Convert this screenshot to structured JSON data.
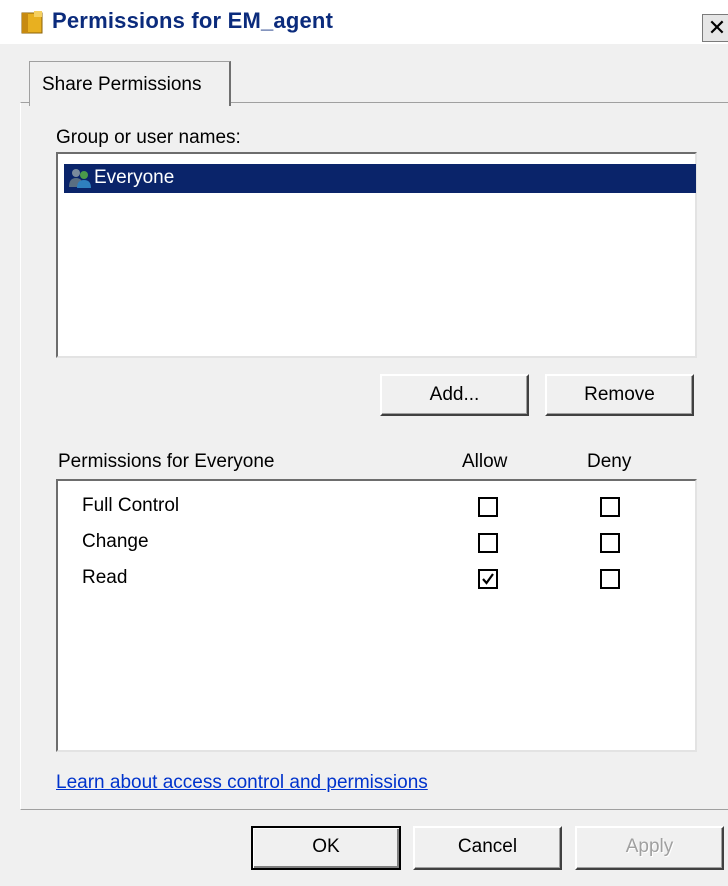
{
  "window": {
    "title": "Permissions for EM_agent",
    "close_label": "✕"
  },
  "tabs": [
    {
      "label": "Share Permissions"
    }
  ],
  "group_label": "Group or user names:",
  "users": [
    {
      "name": "Everyone",
      "selected": true
    }
  ],
  "buttons": {
    "add": "Add...",
    "remove": "Remove",
    "ok": "OK",
    "cancel": "Cancel",
    "apply": "Apply"
  },
  "permissions": {
    "header": "Permissions for Everyone",
    "allow_header": "Allow",
    "deny_header": "Deny",
    "rows": [
      {
        "name": "Full Control",
        "allow": false,
        "deny": false
      },
      {
        "name": "Change",
        "allow": false,
        "deny": false
      },
      {
        "name": "Read",
        "allow": true,
        "deny": false
      }
    ]
  },
  "link": "Learn about access control and permissions",
  "colors": {
    "selection": "#0a246a",
    "title_text": "#0b2b7c",
    "link": "#0033cc"
  }
}
